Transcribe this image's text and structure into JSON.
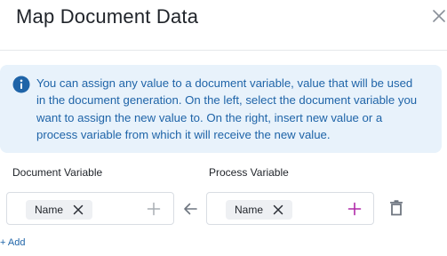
{
  "dialog": {
    "title": "Map Document Data"
  },
  "info": {
    "text": "You can assign any value to a document variable, value that will be used in the document generation. On the left, select the document variable you want to assign the new value to. On the right, insert new value or a process variable from which it will receive the new value."
  },
  "mapping": {
    "document_label": "Document Variable",
    "process_label": "Process Variable",
    "rows": [
      {
        "document_chip": "Name",
        "process_chip": "Name"
      }
    ],
    "add_label": "+ Add"
  },
  "colors": {
    "info_bg": "#e8f2fb",
    "info_text": "#1f64a8",
    "process_add": "#b02aa8",
    "document_add": "#a8adb4"
  },
  "icons": {
    "close": "close-icon",
    "info": "info-icon",
    "chip_remove": "close-icon",
    "document_add": "plus-icon",
    "process_add": "plus-icon",
    "arrow": "arrow-left-icon",
    "delete": "trash-icon"
  }
}
